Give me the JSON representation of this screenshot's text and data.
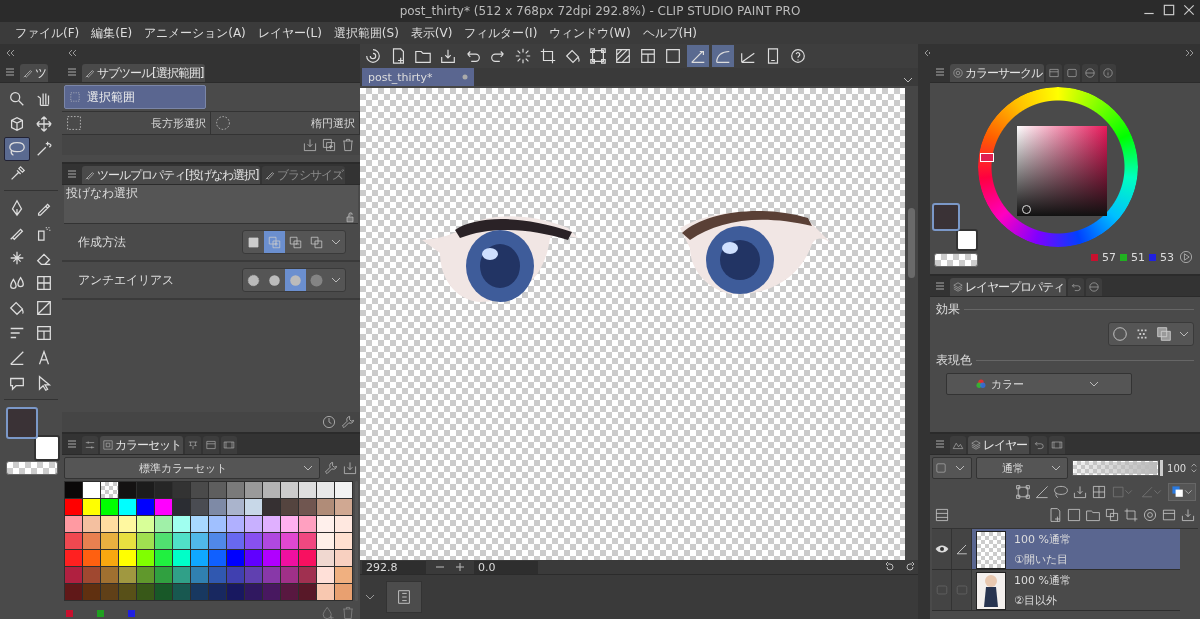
{
  "window": {
    "title": "post_thirty* (512 x 768px 72dpi 292.8%)  - CLIP STUDIO PAINT PRO"
  },
  "menu": [
    "ファイル(F)",
    "編集(E)",
    "アニメーション(A)",
    "レイヤー(L)",
    "選択範囲(S)",
    "表示(V)",
    "フィルター(I)",
    "ウィンドウ(W)",
    "ヘルプ(H)"
  ],
  "tool_palette": {
    "tab": "ツ",
    "groups": [
      {
        "tools": [
          {
            "kind": "zoom",
            "selected": false
          },
          {
            "kind": "hand",
            "selected": false
          },
          {
            "kind": "object",
            "selected": false
          },
          {
            "kind": "move",
            "selected": false
          },
          {
            "kind": "lasso",
            "selected": true
          },
          {
            "kind": "wand",
            "selected": false
          },
          {
            "kind": "eyedropper",
            "selected": false
          }
        ]
      },
      {
        "tools": [
          {
            "kind": "pen",
            "selected": false
          },
          {
            "kind": "pencil",
            "selected": false
          },
          {
            "kind": "brush",
            "selected": false
          },
          {
            "kind": "airbrush",
            "selected": false
          },
          {
            "kind": "decoration",
            "selected": false
          },
          {
            "kind": "eraser",
            "selected": false
          },
          {
            "kind": "blend",
            "selected": false
          },
          {
            "kind": "grid",
            "selected": false
          },
          {
            "kind": "fill",
            "selected": false
          },
          {
            "kind": "gradient",
            "selected": false
          },
          {
            "kind": "lines",
            "selected": false
          },
          {
            "kind": "frame",
            "selected": false
          },
          {
            "kind": "ruler",
            "selected": false
          },
          {
            "kind": "text",
            "selected": false
          },
          {
            "kind": "balloon",
            "selected": false
          },
          {
            "kind": "operation",
            "selected": false
          }
        ]
      }
    ],
    "swatches": [
      {
        "kind": "main",
        "color": "#3a3236"
      },
      {
        "kind": "sub",
        "color": "#ffffff"
      }
    ]
  },
  "subtool": {
    "tab": "サブツール[選択範囲]",
    "group": "選択範囲",
    "items": [
      {
        "label": "長方形選択",
        "kind": "rect"
      },
      {
        "label": "楕円選択",
        "kind": "ellipse"
      }
    ]
  },
  "tool_property": {
    "tabs": [
      {
        "label": "ツールプロパティ[投げなわ選択]",
        "selected": true
      },
      {
        "label": "ブラシサイズ",
        "selected": false
      }
    ],
    "tool_name": "投げなわ選択",
    "properties": [
      {
        "label": "作成方法",
        "options": [
          {
            "kind": "new",
            "selected": false
          },
          {
            "kind": "add",
            "selected": true
          },
          {
            "kind": "subtract",
            "selected": false
          },
          {
            "kind": "intersect",
            "selected": false
          }
        ]
      },
      {
        "label": "アンチエイリアス",
        "options": [
          {
            "kind": "aa-none",
            "selected": false
          },
          {
            "kind": "aa-weak",
            "selected": false
          },
          {
            "kind": "aa-mid",
            "selected": true
          },
          {
            "kind": "aa-strong",
            "selected": false
          }
        ]
      }
    ]
  },
  "color_set": {
    "tabs": [
      {
        "kind": "sliders",
        "selected": false
      },
      {
        "kind": "palette",
        "label": "カラーセット",
        "selected": true
      },
      {
        "kind": "mix",
        "selected": false
      },
      {
        "kind": "window",
        "selected": false
      },
      {
        "kind": "film",
        "selected": false
      }
    ],
    "set_name": "標準カラーセット",
    "rows": [
      [
        {
          "kind": "color",
          "color": "#0a0808"
        },
        {
          "kind": "color",
          "color": "#ffffff"
        },
        {
          "kind": "transparent"
        },
        {
          "kind": "color",
          "color": "#141212"
        },
        {
          "kind": "color",
          "color": "#1c1c1c"
        },
        {
          "kind": "color",
          "color": "#262626"
        },
        {
          "kind": "color",
          "color": "#333333"
        },
        {
          "kind": "color",
          "color": "#4a4a4a"
        },
        {
          "kind": "color",
          "color": "#5e5e5e"
        },
        {
          "kind": "color",
          "color": "#7a7a7a"
        },
        {
          "kind": "color",
          "color": "#9a9a9a"
        },
        {
          "kind": "color",
          "color": "#b4b4b4"
        },
        {
          "kind": "color",
          "color": "#cccccc"
        },
        {
          "kind": "color",
          "color": "#dedede"
        },
        {
          "kind": "color",
          "color": "#e8e8e8"
        },
        {
          "kind": "color",
          "color": "#f2f2f2"
        }
      ],
      [
        {
          "kind": "color",
          "color": "#ff0000"
        },
        {
          "kind": "color",
          "color": "#ffff00"
        },
        {
          "kind": "color",
          "color": "#00ff00"
        },
        {
          "kind": "color",
          "color": "#00ffff"
        },
        {
          "kind": "color",
          "color": "#0000ff"
        },
        {
          "kind": "color",
          "color": "#ff00ff"
        },
        {
          "kind": "color",
          "color": "#2b2d33"
        },
        {
          "kind": "color",
          "color": "#4a4c52"
        },
        {
          "kind": "color",
          "color": "#7e8aa6"
        },
        {
          "kind": "color",
          "color": "#aab4cc"
        },
        {
          "kind": "color",
          "color": "#c8d8e8"
        },
        {
          "kind": "color",
          "color": "#363032"
        },
        {
          "kind": "color",
          "color": "#54443f"
        },
        {
          "kind": "color",
          "color": "#705650"
        },
        {
          "kind": "color",
          "color": "#b08c78"
        },
        {
          "kind": "color",
          "color": "#d0a892"
        }
      ],
      [
        {
          "kind": "color",
          "color": "#ff9aa2"
        },
        {
          "kind": "color",
          "color": "#f4c0a0"
        },
        {
          "kind": "color",
          "color": "#ffdca0"
        },
        {
          "kind": "color",
          "color": "#fff8a0"
        },
        {
          "kind": "color",
          "color": "#d8ff98"
        },
        {
          "kind": "color",
          "color": "#a0f0a8"
        },
        {
          "kind": "color",
          "color": "#a0fff0"
        },
        {
          "kind": "color",
          "color": "#a8d8ff"
        },
        {
          "kind": "color",
          "color": "#a0c0ff"
        },
        {
          "kind": "color",
          "color": "#b0b0ff"
        },
        {
          "kind": "color",
          "color": "#c8b0ff"
        },
        {
          "kind": "color",
          "color": "#e0b0ff"
        },
        {
          "kind": "color",
          "color": "#ffb0f0"
        },
        {
          "kind": "color",
          "color": "#ffa0c0"
        },
        {
          "kind": "color",
          "color": "#fff0ec"
        },
        {
          "kind": "color",
          "color": "#ffe8e0"
        }
      ],
      [
        {
          "kind": "color",
          "color": "#f04850"
        },
        {
          "kind": "color",
          "color": "#e88050"
        },
        {
          "kind": "color",
          "color": "#e8b040"
        },
        {
          "kind": "color",
          "color": "#e8e040"
        },
        {
          "kind": "color",
          "color": "#a0e050"
        },
        {
          "kind": "color",
          "color": "#50e070"
        },
        {
          "kind": "color",
          "color": "#50e0c8"
        },
        {
          "kind": "color",
          "color": "#50b8e8"
        },
        {
          "kind": "color",
          "color": "#5088e8"
        },
        {
          "kind": "color",
          "color": "#6868f0"
        },
        {
          "kind": "color",
          "color": "#8850f0"
        },
        {
          "kind": "color",
          "color": "#b048e0"
        },
        {
          "kind": "color",
          "color": "#e048d0"
        },
        {
          "kind": "color",
          "color": "#f04880"
        },
        {
          "kind": "color",
          "color": "#fff0e8"
        },
        {
          "kind": "color",
          "color": "#ffe0d0"
        }
      ],
      [
        {
          "kind": "color",
          "color": "#ff2020"
        },
        {
          "kind": "color",
          "color": "#ff6010"
        },
        {
          "kind": "color",
          "color": "#f8a810"
        },
        {
          "kind": "color",
          "color": "#ffff00"
        },
        {
          "kind": "color",
          "color": "#80ff00"
        },
        {
          "kind": "color",
          "color": "#20f040"
        },
        {
          "kind": "color",
          "color": "#00ffc8"
        },
        {
          "kind": "color",
          "color": "#10a8ff"
        },
        {
          "kind": "color",
          "color": "#1060ff"
        },
        {
          "kind": "color",
          "color": "#0000ff"
        },
        {
          "kind": "color",
          "color": "#6000ff"
        },
        {
          "kind": "color",
          "color": "#b000ff"
        },
        {
          "kind": "color",
          "color": "#f010a0"
        },
        {
          "kind": "color",
          "color": "#f81060"
        },
        {
          "kind": "color",
          "color": "#f0d8d0"
        },
        {
          "kind": "color",
          "color": "#f8d0c0"
        }
      ],
      [
        {
          "kind": "color",
          "color": "#b02040"
        },
        {
          "kind": "color",
          "color": "#a04830"
        },
        {
          "kind": "color",
          "color": "#a07030"
        },
        {
          "kind": "color",
          "color": "#a09840"
        },
        {
          "kind": "color",
          "color": "#60982c"
        },
        {
          "kind": "color",
          "color": "#30a040"
        },
        {
          "kind": "color",
          "color": "#30a088"
        },
        {
          "kind": "color",
          "color": "#3080b0"
        },
        {
          "kind": "color",
          "color": "#3058b0"
        },
        {
          "kind": "color",
          "color": "#4040b0"
        },
        {
          "kind": "color",
          "color": "#6040b0"
        },
        {
          "kind": "color",
          "color": "#8838a8"
        },
        {
          "kind": "color",
          "color": "#a03088"
        },
        {
          "kind": "color",
          "color": "#a03050"
        },
        {
          "kind": "color",
          "color": "#ffe0d8"
        },
        {
          "kind": "color",
          "color": "#f0b080"
        }
      ],
      [
        {
          "kind": "color",
          "color": "#601818"
        },
        {
          "kind": "color",
          "color": "#603010"
        },
        {
          "kind": "color",
          "color": "#604018"
        },
        {
          "kind": "color",
          "color": "#585018"
        },
        {
          "kind": "color",
          "color": "#385818"
        },
        {
          "kind": "color",
          "color": "#185828"
        },
        {
          "kind": "color",
          "color": "#185850"
        },
        {
          "kind": "color",
          "color": "#183860"
        },
        {
          "kind": "color",
          "color": "#182860"
        },
        {
          "kind": "color",
          "color": "#181860"
        },
        {
          "kind": "color",
          "color": "#301860"
        },
        {
          "kind": "color",
          "color": "#481860"
        },
        {
          "kind": "color",
          "color": "#581840"
        },
        {
          "kind": "color",
          "color": "#581828"
        },
        {
          "kind": "color",
          "color": "#f8c8b0"
        },
        {
          "kind": "color",
          "color": "#e8a070"
        }
      ]
    ],
    "channel_marks": [
      {
        "color": "#c8102e"
      },
      {
        "color": "#20a020"
      },
      {
        "color": "#2020e0"
      }
    ]
  },
  "command_bar": [
    {
      "kind": "logo",
      "on": false
    },
    {
      "kind": "new",
      "on": false
    },
    {
      "kind": "open",
      "on": false
    },
    {
      "kind": "save",
      "on": false
    },
    {
      "kind": "undo",
      "on": false
    },
    {
      "kind": "redo",
      "on": false
    },
    {
      "kind": "spinner",
      "on": false
    },
    {
      "kind": "crop",
      "on": false
    },
    {
      "kind": "fill",
      "on": false
    },
    {
      "kind": "transform",
      "on": false
    },
    {
      "kind": "hatch",
      "on": false
    },
    {
      "kind": "frame",
      "on": false
    },
    {
      "kind": "square",
      "on": false
    },
    {
      "kind": "snap-ruler",
      "on": true
    },
    {
      "kind": "snap-curve",
      "on": true
    },
    {
      "kind": "snap-grid",
      "on": false
    },
    {
      "kind": "device",
      "on": false
    },
    {
      "kind": "help",
      "on": false
    }
  ],
  "document": {
    "tab": "post_thirty*",
    "zoom": "292.8",
    "angle": "0.0"
  },
  "color_circle": {
    "tabs": [
      {
        "kind": "circle",
        "label": "カラーサークル",
        "selected": true
      },
      {
        "kind": "window",
        "selected": false
      },
      {
        "kind": "rounded",
        "selected": false
      },
      {
        "kind": "globe",
        "selected": false
      },
      {
        "kind": "info",
        "selected": false
      }
    ],
    "readings": [
      {
        "color": "#c8102e",
        "value": "57"
      },
      {
        "color": "#20b020",
        "value": "51"
      },
      {
        "color": "#2020e0",
        "value": "53"
      }
    ]
  },
  "layer_property": {
    "tabs": [
      {
        "kind": "stack",
        "label": "レイヤープロパティ",
        "selected": true
      },
      {
        "kind": "undo",
        "selected": false
      },
      {
        "kind": "globe",
        "selected": false
      }
    ],
    "effect_label": "効果",
    "color_label": "表現色",
    "color_mode": "カラー"
  },
  "layers": {
    "tabs": [
      {
        "kind": "mountain",
        "selected": false
      },
      {
        "kind": "stack",
        "label": "レイヤー",
        "selected": true
      },
      {
        "kind": "undo",
        "selected": false
      },
      {
        "kind": "film",
        "selected": false
      }
    ],
    "blend_mode": "通常",
    "opacity": {
      "level": 1,
      "reading": "100"
    },
    "items": [
      {
        "mode": "100 %通常",
        "name": "①開いた目",
        "kind": "transparent",
        "selected": true,
        "visible": true,
        "editing": true
      },
      {
        "mode": "100 %通常",
        "name": "②目以外",
        "kind": "figure",
        "selected": false,
        "visible": false,
        "editing": false
      }
    ]
  }
}
